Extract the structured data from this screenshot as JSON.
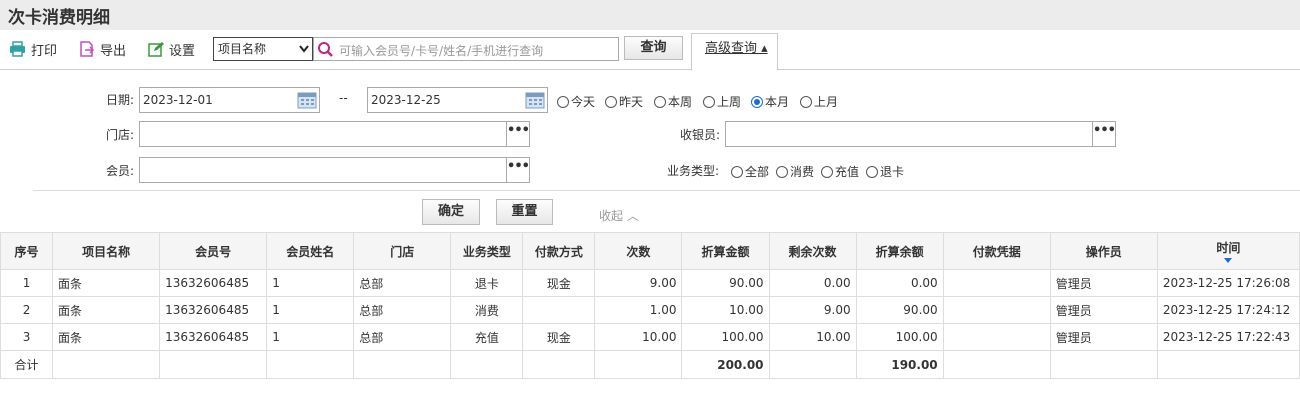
{
  "page_title": "次卡消费明细",
  "toolbar": {
    "print_label": "打印",
    "export_label": "导出",
    "settings_label": "设置",
    "field_select": "项目名称",
    "search_placeholder": "可输入会员号/卡号/姓名/手机进行查询",
    "query_label": "查询",
    "advanced_label": "高级查询 ▴"
  },
  "filters": {
    "date_label": "日期:",
    "date_from": "2023-12-01",
    "date_sep": "--",
    "date_to": "2023-12-25",
    "date_options": [
      "今天",
      "昨天",
      "本周",
      "上周",
      "本月",
      "上月"
    ],
    "date_selected": "本月",
    "store_label": "门店:",
    "cashier_label": "收银员:",
    "member_label": "会员:",
    "biz_type_label": "业务类型:",
    "biz_type_options": [
      "全部",
      "消费",
      "充值",
      "退卡"
    ],
    "confirm_label": "确定",
    "reset_label": "重置",
    "collapse_label": "收起 ︿"
  },
  "table": {
    "columns": [
      "序号",
      "项目名称",
      "会员号",
      "会员姓名",
      "门店",
      "业务类型",
      "付款方式",
      "次数",
      "折算金额",
      "剩余次数",
      "折算余额",
      "付款凭据",
      "操作员",
      "时间"
    ],
    "rows": [
      [
        "1",
        "面条",
        "13632606485",
        "1",
        "总部",
        "退卡",
        "现金",
        "9.00",
        "90.00",
        "0.00",
        "0.00",
        "",
        "管理员",
        "2023-12-25 17:26:08"
      ],
      [
        "2",
        "面条",
        "13632606485",
        "1",
        "总部",
        "消费",
        "",
        "1.00",
        "10.00",
        "9.00",
        "90.00",
        "",
        "管理员",
        "2023-12-25 17:24:12"
      ],
      [
        "3",
        "面条",
        "13632606485",
        "1",
        "总部",
        "充值",
        "现金",
        "10.00",
        "100.00",
        "10.00",
        "100.00",
        "",
        "管理员",
        "2023-12-25 17:22:43"
      ]
    ],
    "total_label": "合计",
    "total_amount": "200.00",
    "total_balance": "190.00"
  }
}
